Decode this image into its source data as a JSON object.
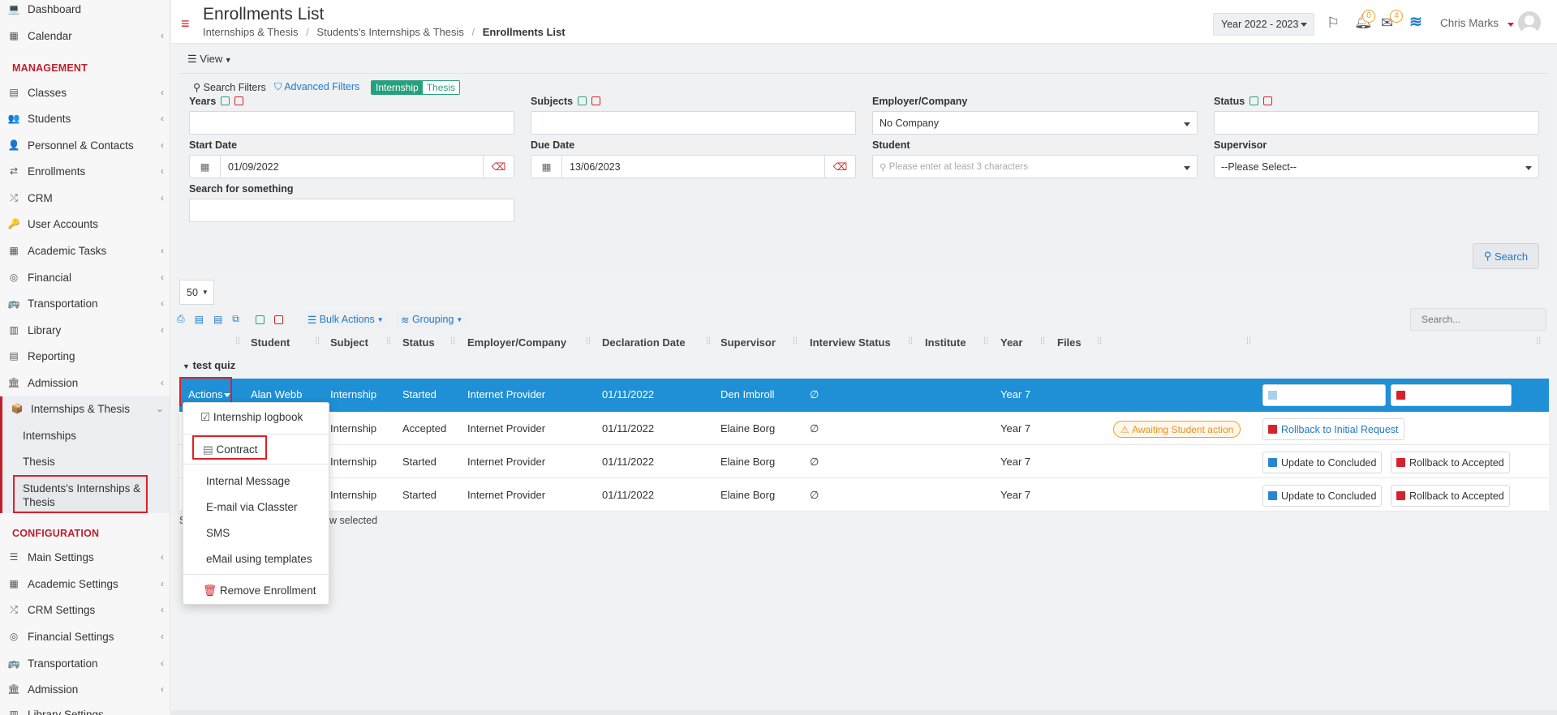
{
  "sidebar": {
    "items": [
      {
        "label": "Dashboard",
        "icon": "laptop-icon"
      },
      {
        "label": "Calendar",
        "icon": "calendar-icon"
      },
      {
        "label": "Classes",
        "icon": "classes-icon"
      },
      {
        "label": "Students",
        "icon": "students-icon"
      },
      {
        "label": "Personnel & Contacts",
        "icon": "personnel-icon"
      },
      {
        "label": "Enrollments",
        "icon": "exchange-icon"
      },
      {
        "label": "CRM",
        "icon": "crm-icon"
      },
      {
        "label": "User Accounts",
        "icon": "key-icon"
      },
      {
        "label": "Academic Tasks",
        "icon": "grid-icon"
      },
      {
        "label": "Financial",
        "icon": "coins-icon"
      },
      {
        "label": "Transportation",
        "icon": "bus-icon"
      },
      {
        "label": "Library",
        "icon": "library-icon"
      },
      {
        "label": "Reporting",
        "icon": "report-icon"
      },
      {
        "label": "Admission",
        "icon": "building-icon"
      },
      {
        "label": "Internships & Thesis",
        "icon": "box-icon"
      },
      {
        "label": "Main Settings",
        "icon": "sliders-icon"
      },
      {
        "label": "Academic Settings",
        "icon": "grid-icon"
      },
      {
        "label": "CRM Settings",
        "icon": "crm-icon"
      },
      {
        "label": "Financial Settings",
        "icon": "coins-icon"
      },
      {
        "label": "Transportation",
        "icon": "bus-icon"
      },
      {
        "label": "Admission",
        "icon": "building-icon"
      },
      {
        "label": "Library Settings",
        "icon": "library-icon"
      }
    ],
    "management_heading": "MANAGEMENT",
    "configuration_heading": "CONFIGURATION",
    "sub_items": [
      "Internships",
      "Thesis",
      "Students's Internships & Thesis"
    ]
  },
  "header": {
    "title": "Enrollments List",
    "breadcrumb": [
      "Internships & Thesis",
      "Students's Internships & Thesis",
      "Enrollments List"
    ],
    "year_select": "Year 2022 - 2023",
    "bell_count": "0",
    "mail_count": "4",
    "user_name": "Chris Marks"
  },
  "toolbar": {
    "view_label": "View"
  },
  "filters": {
    "search_filters": "Search Filters",
    "advanced_filters": "Advanced Filters",
    "toggle": [
      "Internship",
      "Thesis"
    ],
    "years_label": "Years",
    "subjects_label": "Subjects",
    "employer_label": "Employer/Company",
    "employer_value": "No Company",
    "status_label": "Status",
    "start_date_label": "Start Date",
    "start_date_value": "01/09/2022",
    "due_date_label": "Due Date",
    "due_date_value": "13/06/2023",
    "student_label": "Student",
    "student_placeholder": "Please enter at least 3 characters",
    "supervisor_label": "Supervisor",
    "supervisor_value": "--Please Select--",
    "search_something_label": "Search for something",
    "search_button": "Search"
  },
  "table_controls": {
    "page_size": "50",
    "bulk_actions": "Bulk Actions",
    "grouping": "Grouping",
    "search_placeholder": "Search..."
  },
  "table": {
    "columns": [
      "Student",
      "Subject",
      "Status",
      "Employer/Company",
      "Declaration Date",
      "Supervisor",
      "Interview Status",
      "Institute",
      "Year",
      "Files"
    ],
    "group_label": "test quiz",
    "rows": [
      {
        "student": "Alan Webb",
        "subject": "Internship",
        "status": "Started",
        "employer": "Internet Provider",
        "declaration": "01/11/2022",
        "supervisor": "Den Imbroll",
        "interview": "∅",
        "year": "Year 7"
      },
      {
        "student": "",
        "subject": "Internship",
        "status": "Accepted",
        "employer": "Internet Provider",
        "declaration": "01/11/2022",
        "supervisor": "Elaine Borg",
        "interview": "∅",
        "year": "Year 7"
      },
      {
        "student": "",
        "subject": "Internship",
        "status": "Started",
        "employer": "Internet Provider",
        "declaration": "01/11/2022",
        "supervisor": "Elaine Borg",
        "interview": "∅",
        "year": "Year 7"
      },
      {
        "student": "",
        "subject": "Internship",
        "status": "Started",
        "employer": "Internet Provider",
        "declaration": "01/11/2022",
        "supervisor": "Elaine Borg",
        "interview": "∅",
        "year": "Year 7"
      }
    ],
    "awaiting_badge": "Awaiting Student action",
    "rollback_initial": "Rollback to Initial Request",
    "update_concluded": "Update to Concluded",
    "rollback_accepted": "Rollback to Accepted",
    "footer_left": "S",
    "footer_text": "w selected"
  },
  "actions_menu": {
    "button": "Actions",
    "items": [
      "Internship logbook",
      "Contract",
      "Internal Message",
      "E-mail via Classter",
      "SMS",
      "eMail using templates",
      "Remove Enrollment"
    ]
  },
  "colors": {
    "accent": "#2a86d0",
    "selected_row": "#1f8fd6",
    "danger": "#e01f26",
    "teal": "#27a17d"
  }
}
